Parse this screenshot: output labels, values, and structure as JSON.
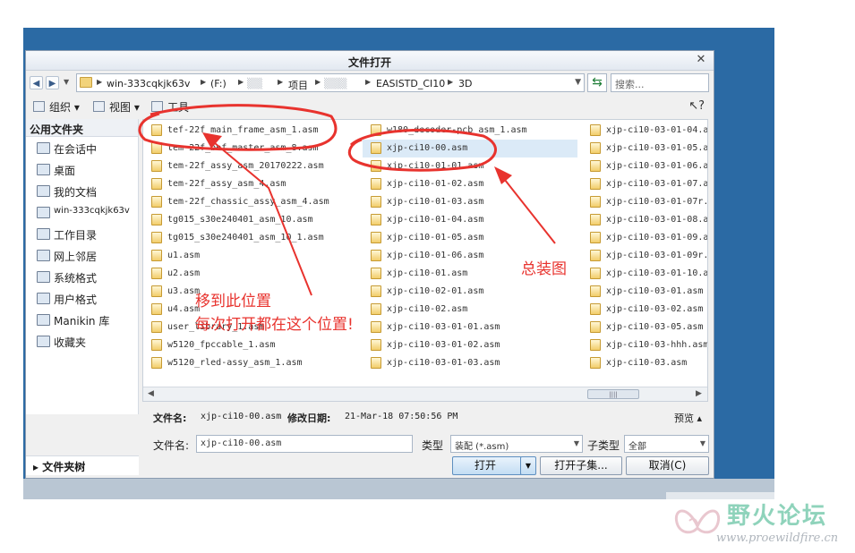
{
  "dialog": {
    "title": "文件打开",
    "close_glyph": "✕"
  },
  "address": {
    "crumbs": [
      "win-333cqkjk63v",
      "(F:)",
      "项目",
      "EASISTD_CI10",
      "3D"
    ],
    "search_placeholder": "搜索..."
  },
  "toolbar": {
    "organize": "组织",
    "view": "视图",
    "tools": "工具",
    "help_glyph": "?"
  },
  "sidebar": {
    "header": "公用文件夹",
    "items": [
      {
        "label": "在会话中",
        "icon": "monitor-icon"
      },
      {
        "label": "桌面",
        "icon": "desktop-icon"
      },
      {
        "label": "我的文档",
        "icon": "documents-icon"
      },
      {
        "label": "win-333cqkjk63v",
        "icon": "computer-icon"
      },
      {
        "label": "工作目录",
        "icon": "working-dir-icon"
      },
      {
        "label": "网上邻居",
        "icon": "network-icon"
      },
      {
        "label": "系统格式",
        "icon": "folder-icon"
      },
      {
        "label": "用户格式",
        "icon": "folder-icon"
      },
      {
        "label": "Manikin 库",
        "icon": "folder-icon"
      },
      {
        "label": "收藏夹",
        "icon": "favorites-icon"
      }
    ],
    "footer": "文件夹树"
  },
  "files": {
    "columns": [
      [
        "tef-22f_main_frame_asm_1.asm",
        "tem-22f_bef_master_asm_8.asm",
        "tem-22f_assy_asm_20170222.asm",
        "tem-22f_assy_asm_4.asm",
        "tem-22f_chassic_assy_asm_4.asm",
        "tg015_s30e240401_asm_10.asm",
        "tg015_s30e240401_asm_10_1.asm",
        "u1.asm",
        "u2.asm",
        "u3.asm",
        "u4.asm",
        "user_library_1.asm",
        "w5120_fpccable_1.asm",
        "w5120_rled-assy_asm_1.asm"
      ],
      [
        "w180_decoder-pcb_asm_1.asm",
        "xjp-ci10-00.asm",
        "xjp-ci10-01-01.asm",
        "xjp-ci10-01-02.asm",
        "xjp-ci10-01-03.asm",
        "xjp-ci10-01-04.asm",
        "xjp-ci10-01-05.asm",
        "xjp-ci10-01-06.asm",
        "xjp-ci10-01.asm",
        "xjp-ci10-02-01.asm",
        "xjp-ci10-02.asm",
        "xjp-ci10-03-01-01.asm",
        "xjp-ci10-03-01-02.asm",
        "xjp-ci10-03-01-03.asm"
      ],
      [
        "xjp-ci10-03-01-04.a",
        "xjp-ci10-03-01-05.a",
        "xjp-ci10-03-01-06.a",
        "xjp-ci10-03-01-07.a",
        "xjp-ci10-03-01-07r.",
        "xjp-ci10-03-01-08.a",
        "xjp-ci10-03-01-09.a",
        "xjp-ci10-03-01-09r.",
        "xjp-ci10-03-01-10.a",
        "xjp-ci10-03-01.asm",
        "xjp-ci10-03-02.asm",
        "xjp-ci10-03-05.asm",
        "xjp-ci10-03-hhh.asm",
        "xjp-ci10-03.asm"
      ]
    ],
    "selected": [
      1,
      1
    ]
  },
  "details": {
    "name_label": "文件名:",
    "name_value": "xjp-ci10-00.asm",
    "date_label": "修改日期:",
    "date_value": "21-Mar-18 07:50:56 PM",
    "preview": "预览"
  },
  "form": {
    "filename_label": "文件名:",
    "filename_value": "xjp-ci10-00.asm",
    "type_label": "类型",
    "type_value": "装配 (*.asm)",
    "subtype_label": "子类型",
    "subtype_value": "全部",
    "open_button": "打开",
    "open_subset_button": "打开子集...",
    "cancel_button": "取消(C)"
  },
  "annotations": {
    "move_here": "移到此位置",
    "every_time": "每次打开都在这个位置!",
    "main_assembly": "总装图",
    "color": "#e8332e"
  },
  "watermark": {
    "name": "野火论坛",
    "url": "www.proewildfire.cn"
  }
}
